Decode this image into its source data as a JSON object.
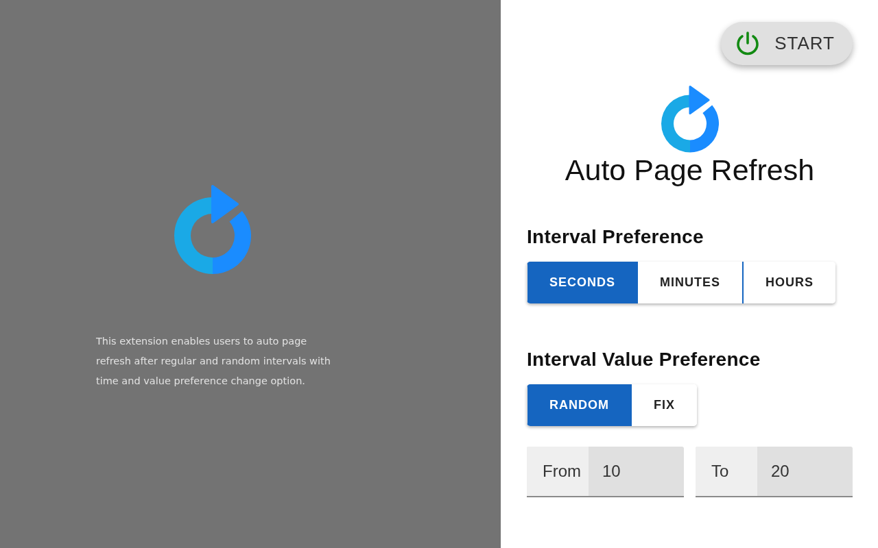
{
  "promo": {
    "description": "This extension enables users to auto page refresh after regular and random intervals with time and value preference change option."
  },
  "start_button": {
    "label": "START"
  },
  "title": "Auto Page Refresh",
  "sections": [
    {
      "heading": "Interval Preference",
      "options": [
        {
          "label": "SECONDS",
          "selected": true
        },
        {
          "label": "MINUTES",
          "selected": false
        },
        {
          "label": "HOURS",
          "selected": false
        }
      ]
    },
    {
      "heading": "Interval Value Preference",
      "options": [
        {
          "label": "RANDOM",
          "selected": true
        },
        {
          "label": "FIX",
          "selected": false
        }
      ]
    }
  ],
  "fields": [
    {
      "label": "From",
      "value": "10"
    },
    {
      "label": "To",
      "value": "20"
    }
  ]
}
